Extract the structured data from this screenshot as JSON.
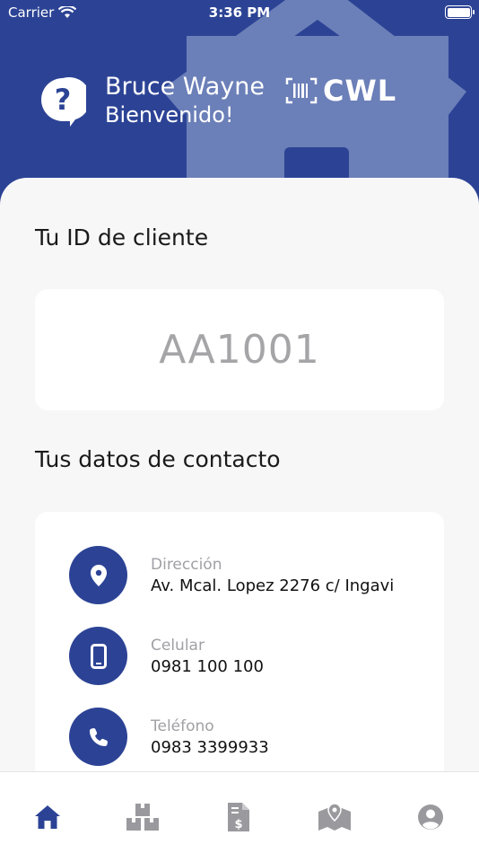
{
  "status_bar": {
    "carrier": "Carrier",
    "time": "3:36 PM"
  },
  "header": {
    "user_name": "Bruce Wayne",
    "welcome": "Bienvenido!",
    "logo_text": "CWL",
    "icons": [
      "help-bubble-icon",
      "barcode-icon"
    ]
  },
  "client_id_section": {
    "title": "Tu ID de cliente",
    "client_id": "AA1001"
  },
  "contact_section": {
    "title": "Tus datos de contacto",
    "items": [
      {
        "label": "Dirección",
        "value": "Av. Mcal. Lopez 2276 c/ Ingavi",
        "icon": "location-pin-icon"
      },
      {
        "label": "Celular",
        "value": "0981 100 100",
        "icon": "mobile-phone-icon"
      },
      {
        "label": "Teléfono",
        "value": "0983 3399933",
        "icon": "phone-icon"
      }
    ]
  },
  "tabbar": {
    "tabs": [
      {
        "icon": "home-icon",
        "active": true
      },
      {
        "icon": "boxes-icon",
        "active": false
      },
      {
        "icon": "invoice-icon",
        "active": false
      },
      {
        "icon": "map-pin-icon",
        "active": false
      },
      {
        "icon": "account-icon",
        "active": false
      }
    ]
  },
  "colors": {
    "primary": "#2c4395",
    "house": "#6b7fb8",
    "background": "#f7f7f8",
    "inactive_icon": "#9a9a9e"
  }
}
